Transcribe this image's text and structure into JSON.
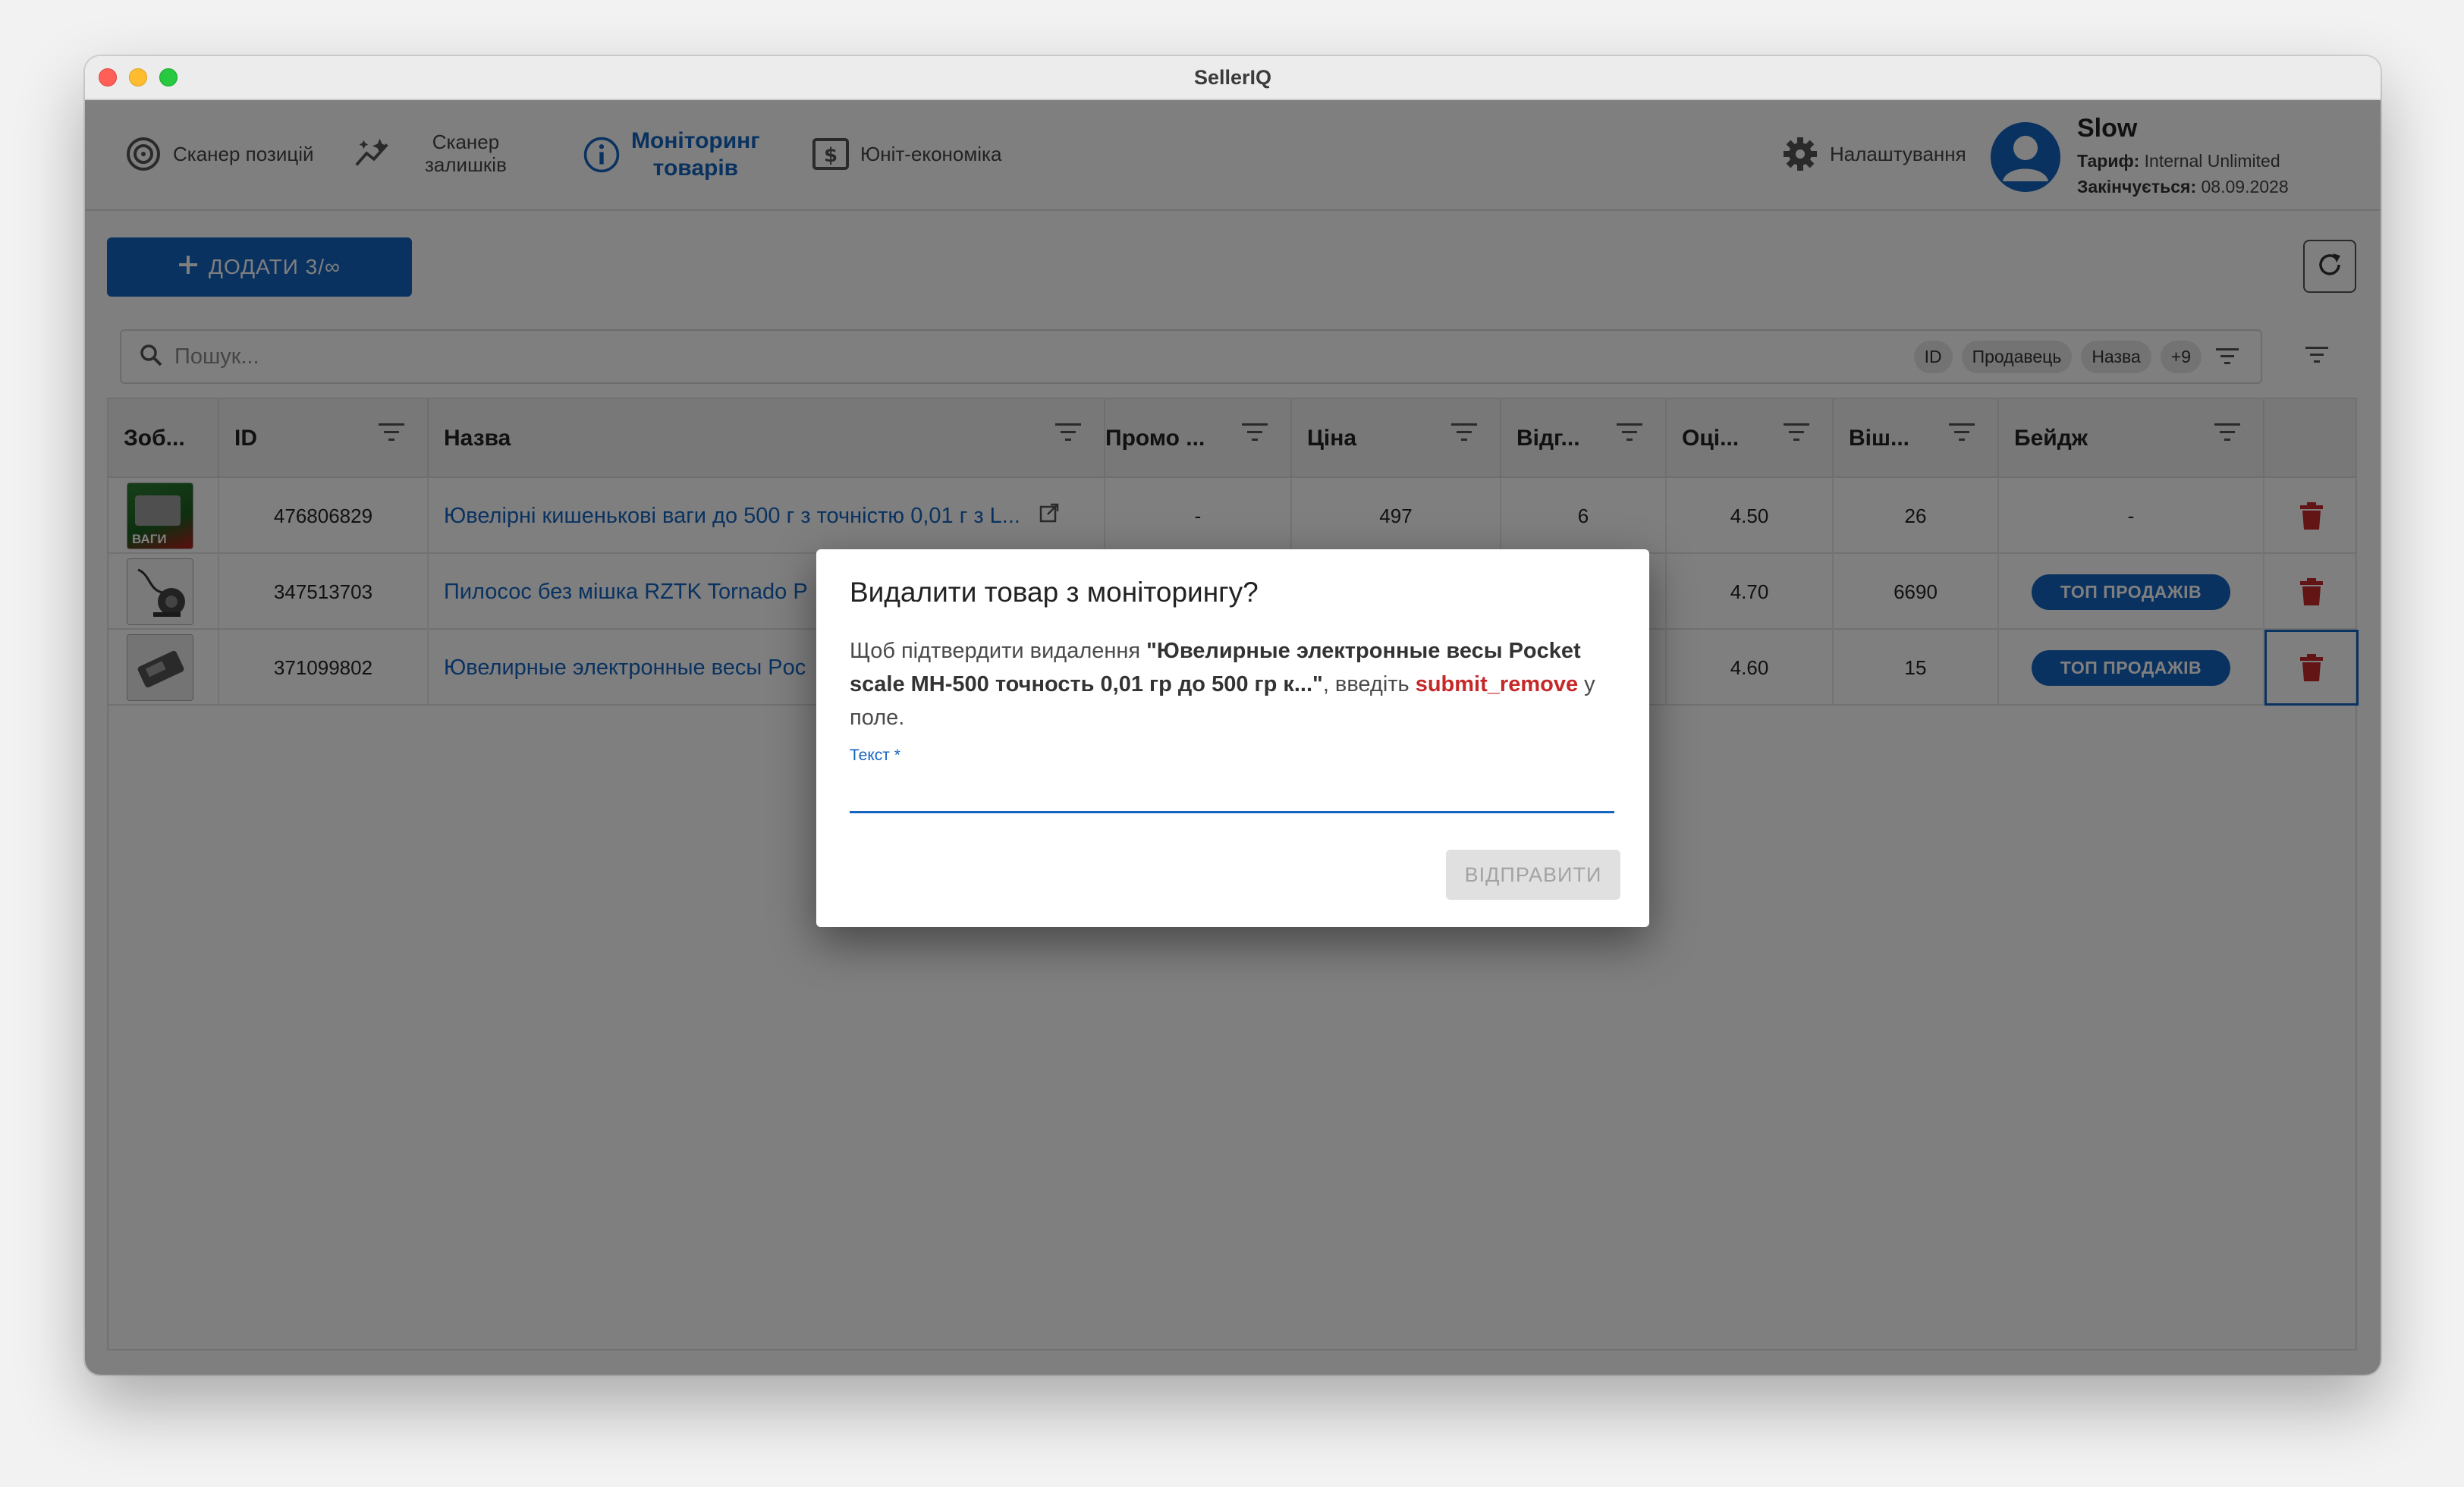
{
  "window": {
    "title": "SellerIQ"
  },
  "nav": {
    "items": [
      {
        "label": "Сканер позицій",
        "icon": "target-icon"
      },
      {
        "label_line1": "Сканер",
        "label_line2": "залишків",
        "icon": "sparkle-trend-icon"
      },
      {
        "label_line1": "Моніторинг",
        "label_line2": "товарів",
        "icon": "info-icon",
        "active": true
      },
      {
        "label": "Юніт-економіка",
        "icon": "dollar-box-icon"
      }
    ],
    "settings_label": "Налаштування"
  },
  "user": {
    "name": "Slow",
    "plan_label": "Тариф:",
    "plan_value": "Internal Unlimited",
    "expires_label": "Закінчується:",
    "expires_value": "08.09.2028"
  },
  "toolbar": {
    "add_label": "ДОДАТИ 3/∞"
  },
  "search": {
    "placeholder": "Пошук...",
    "chips": [
      "ID",
      "Продавець",
      "Назва",
      "+9"
    ]
  },
  "table": {
    "columns": [
      "Зоб...",
      "ID",
      "Назва",
      "Промо ...",
      "Ціна",
      "Відг...",
      "Оці...",
      "Віш...",
      "Бейдж"
    ],
    "rows": [
      {
        "id": "476806829",
        "name": "Ювелірні кишенькові ваги до 500 г з точністю 0,01 г з L...",
        "promo": "-",
        "price": "497",
        "reviews": "6",
        "rating": "4.50",
        "wishlist": "26",
        "badge": "-"
      },
      {
        "id": "347513703",
        "name": "Пилосос без мішка RZTK Tornado P",
        "promo": "",
        "price": "",
        "reviews": "",
        "rating": "4.70",
        "wishlist": "6690",
        "badge": "ТОП ПРОДАЖІВ"
      },
      {
        "id": "371099802",
        "name": "Ювелирные электронные весы Poc",
        "promo": "",
        "price": "",
        "reviews": "",
        "rating": "4.60",
        "wishlist": "15",
        "badge": "ТОП ПРОДАЖІВ"
      }
    ],
    "thumb_text": "ВАГИ"
  },
  "dialog": {
    "title": "Видалити товар з моніторингу?",
    "body_prefix": "Щоб підтвердити видалення ",
    "product": "\"Ювелирные электронные весы Pocket scale MH-500 точность 0,01 гр до 500 гр к...\"",
    "body_mid": ", введіть ",
    "code": "submit_remove",
    "body_suffix": " у поле.",
    "field_label": "Текст *",
    "submit_label": "ВІДПРАВИТИ"
  },
  "colors": {
    "accent": "#1565c0",
    "danger": "#c62828"
  }
}
